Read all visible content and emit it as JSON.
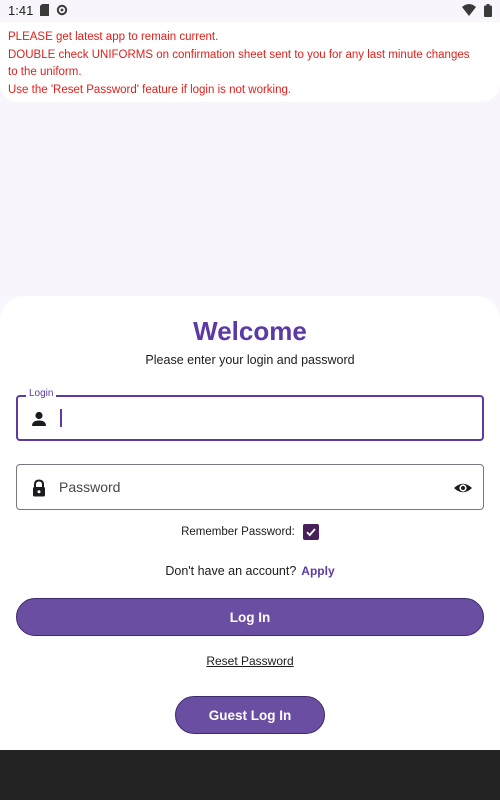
{
  "status_bar": {
    "time": "1:41",
    "icons_left": [
      "sd-card-icon",
      "gear-icon"
    ],
    "icons_right": [
      "wifi-icon",
      "battery-icon"
    ]
  },
  "notice": {
    "lines": [
      "PLEASE get latest app to remain current.",
      "DOUBLE check UNIFORMS on confirmation sheet sent to you for any last minute changes",
      "to the uniform.",
      "Use the 'Reset Password' feature if login is not working."
    ]
  },
  "welcome": {
    "title": "Welcome",
    "subtitle": "Please enter your login and password"
  },
  "login_field": {
    "label": "Login",
    "value": ""
  },
  "password_field": {
    "placeholder": "Password",
    "value": ""
  },
  "remember": {
    "label": "Remember Password:",
    "checked": true
  },
  "account": {
    "prompt": "Don't have an account?",
    "apply_label": "Apply"
  },
  "buttons": {
    "login": "Log In",
    "reset": "Reset Password",
    "guest": "Guest Log In"
  },
  "colors": {
    "accent": "#5b3aa6",
    "button": "#6a4ea2",
    "notice_text": "#e0201b",
    "checkbox": "#4a2058",
    "nav_bar": "#232323"
  }
}
